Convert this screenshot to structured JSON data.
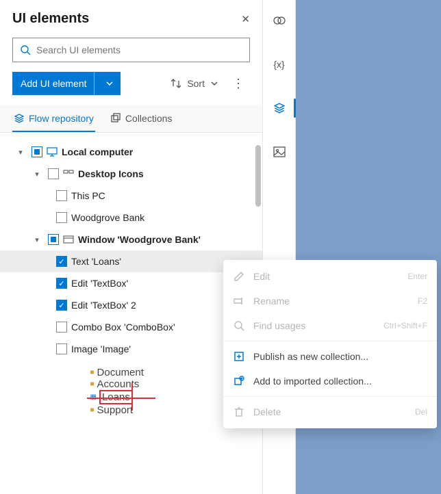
{
  "panel": {
    "title": "UI elements",
    "search_placeholder": "Search UI elements",
    "add_button": "Add UI element",
    "sort_label": "Sort"
  },
  "tabs": {
    "flow": "Flow repository",
    "collections": "Collections"
  },
  "tree": [
    {
      "id": "local",
      "label": "Local computer",
      "depth": 0,
      "bold": true,
      "expanded": true,
      "cbState": "partial",
      "icon": "monitor"
    },
    {
      "id": "desktop",
      "label": "Desktop Icons",
      "depth": 1,
      "bold": true,
      "expanded": true,
      "cbState": "none",
      "icon": "desktop"
    },
    {
      "id": "thispc",
      "label": "This PC",
      "depth": 2,
      "cbState": "none",
      "icon": "none"
    },
    {
      "id": "woodbank",
      "label": "Woodgrove Bank",
      "depth": 2,
      "cbState": "none",
      "icon": "none"
    },
    {
      "id": "winwb",
      "label": "Window 'Woodgrove Bank'",
      "depth": 1,
      "bold": true,
      "expanded": true,
      "cbState": "partial",
      "icon": "window"
    },
    {
      "id": "loans",
      "label": "Text 'Loans'",
      "depth": 3,
      "cbState": "checked",
      "selected": true
    },
    {
      "id": "tb1",
      "label": "Edit 'TextBox'",
      "depth": 3,
      "cbState": "checked"
    },
    {
      "id": "tb2",
      "label": "Edit 'TextBox' 2",
      "depth": 3,
      "cbState": "checked"
    },
    {
      "id": "combo",
      "label": "Combo Box 'ComboBox'",
      "depth": 3,
      "cbState": "none"
    },
    {
      "id": "img",
      "label": "Image 'Image'",
      "depth": 3,
      "cbState": "none"
    }
  ],
  "preview": {
    "lines": [
      "Document",
      "Accounts",
      "Loans",
      "Support"
    ]
  },
  "context_menu": [
    {
      "label": "Edit",
      "shortcut": "Enter",
      "icon": "edit",
      "disabled": true
    },
    {
      "label": "Rename",
      "shortcut": "F2",
      "icon": "rename",
      "disabled": true
    },
    {
      "label": "Find usages",
      "shortcut": "Ctrl+Shift+F",
      "icon": "find",
      "disabled": true
    },
    {
      "type": "sep"
    },
    {
      "label": "Publish as new collection...",
      "icon": "publish",
      "disabled": false
    },
    {
      "label": "Add to imported collection...",
      "icon": "addto",
      "disabled": false
    },
    {
      "type": "sep"
    },
    {
      "label": "Delete",
      "shortcut": "Del",
      "icon": "delete",
      "disabled": true
    }
  ]
}
